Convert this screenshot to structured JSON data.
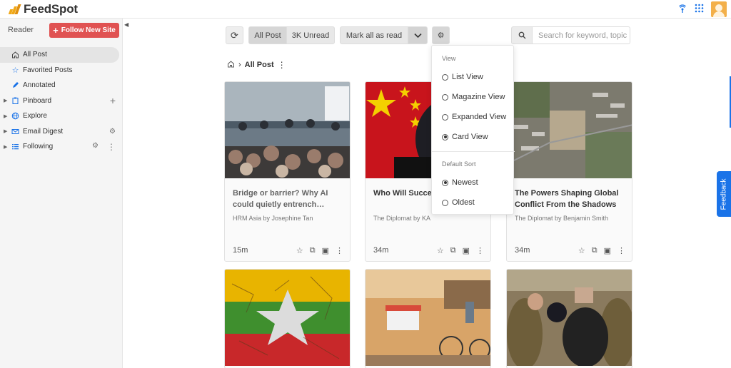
{
  "app": {
    "brand": "FeedSpot"
  },
  "sidebar": {
    "reader_label": "Reader",
    "follow_button": "Follow New Site",
    "items": [
      {
        "label": "All Post",
        "active": true
      },
      {
        "label": "Favorited Posts"
      },
      {
        "label": "Annotated"
      },
      {
        "label": "Pinboard"
      },
      {
        "label": "Explore"
      },
      {
        "label": "Email Digest"
      },
      {
        "label": "Following"
      }
    ]
  },
  "toolbar": {
    "all_post": "All Post",
    "unread": "3K Unread",
    "mark_all": "Mark all as read",
    "search_placeholder": "Search for keyword, topic"
  },
  "breadcrumb": {
    "current": "All Post"
  },
  "dropdown": {
    "view_heading": "View",
    "views": [
      {
        "label": "List View",
        "selected": false
      },
      {
        "label": "Magazine View",
        "selected": false
      },
      {
        "label": "Expanded View",
        "selected": false
      },
      {
        "label": "Card View",
        "selected": true
      }
    ],
    "sort_heading": "Default Sort",
    "sorts": [
      {
        "label": "Newest",
        "selected": true
      },
      {
        "label": "Oldest",
        "selected": false
      }
    ]
  },
  "cards": [
    {
      "title": "Bridge or barrier? Why AI could quietly entrench…",
      "source": "HRM Asia by Josephine Tan",
      "time": "15m"
    },
    {
      "title": "Who Will Succee",
      "source": "The Diplomat by KA",
      "time": "34m"
    },
    {
      "title": "The Powers Shaping Global Conflict From the Shadows",
      "source": "The Diplomat by Benjamin Smith",
      "time": "34m"
    }
  ],
  "feedback": "Feedback",
  "colors": {
    "accent": "#e05252",
    "brand": "#f0a818",
    "feedback": "#1a73e8"
  }
}
